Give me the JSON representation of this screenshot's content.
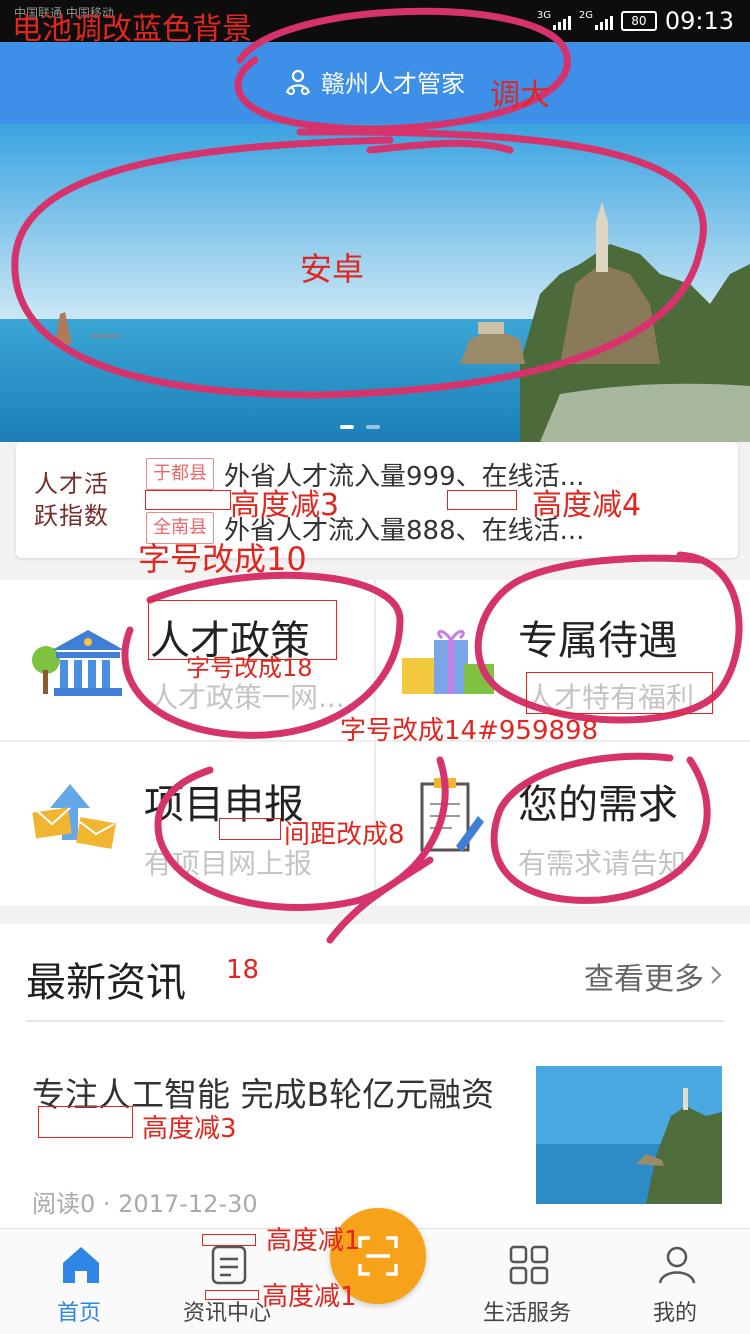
{
  "status_bar": {
    "carrier_text": "中国联通 中国移动",
    "net1": "3G",
    "net2": "2G",
    "battery": "80",
    "time": "09:13"
  },
  "header": {
    "title": "赣州人才管家",
    "logo_icon": "person-logo-icon",
    "bg_color": "#3d8fe8"
  },
  "banner": {
    "scene": "seaside-cliff-tower",
    "slide_count": 2,
    "active_slide": 1
  },
  "activity": {
    "label": "人才活跃指数",
    "rows": [
      {
        "badge": "于都县",
        "text": "外省人才流入量999、在线活..."
      },
      {
        "badge": "全南县",
        "text": "外省人才流入量888、在线活..."
      }
    ]
  },
  "grid": {
    "items": [
      {
        "title": "人才政策",
        "subtitle": "人才政策一网...",
        "icon": "bank-building-icon"
      },
      {
        "title": "专属待遇",
        "subtitle": "人才特有福利",
        "icon": "gift-box-icon"
      },
      {
        "title": "项目申报",
        "subtitle": "有项目网上报",
        "icon": "envelope-upload-icon"
      },
      {
        "title": "您的需求",
        "subtitle": "有需求请告知",
        "icon": "clipboard-pen-icon"
      }
    ]
  },
  "news": {
    "section_title": "最新资讯",
    "more_label": "查看更多",
    "items": [
      {
        "title": "专注人工智能 完成B轮亿元融资",
        "meta": "阅读0 · 2017-12-30"
      }
    ]
  },
  "tabbar": {
    "items": [
      {
        "label": "首页",
        "icon": "home-icon",
        "active": true
      },
      {
        "label": "资讯中心",
        "icon": "news-doc-icon",
        "active": false
      },
      {
        "label": "生活服务",
        "icon": "grid-apps-icon",
        "active": false
      },
      {
        "label": "我的",
        "icon": "user-icon",
        "active": false
      }
    ],
    "center_icon": "scan-icon",
    "accent_color": "#2f86e6",
    "scan_color": "#f7a21b"
  },
  "annotations": {
    "battery_note": "电池调改蓝色背景",
    "title_note": "调大",
    "banner_note": "安卓",
    "height_minus_3a": "高度减3",
    "height_minus_4": "高度减4",
    "font_10": "字号改成10",
    "font_18": "字号改成18",
    "font_14_color": "字号改成14#959898",
    "spacing_8": "间距改成8",
    "size_18": "18",
    "height_minus_3b": "高度减3",
    "height_minus_1a": "高度减1",
    "height_minus_1b": "高度减1",
    "ink_color": "#e0261e",
    "stroke_color": "#d6336c"
  }
}
